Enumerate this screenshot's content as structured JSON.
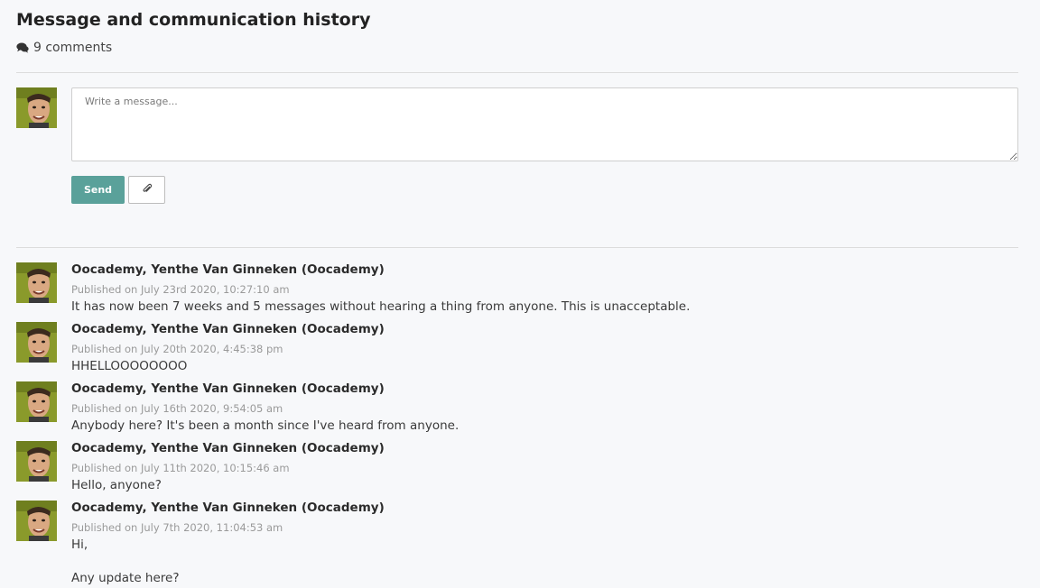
{
  "header": {
    "title": "Message and communication history",
    "comments_count": "9 comments",
    "comments_icon": "comments-icon"
  },
  "composer": {
    "placeholder": "Write a message...",
    "send_label": "Send",
    "attach_icon": "paperclip-icon"
  },
  "colors": {
    "send_button": "#5aa19a",
    "page_background": "#f7f8fa"
  },
  "messages": [
    {
      "author": "Oocademy, Yenthe Van Ginneken (Oocademy)",
      "date": "Published on July 23rd 2020, 10:27:10 am",
      "lines": [
        "It has now been 7 weeks and 5 messages without hearing a thing from anyone. This is unacceptable."
      ]
    },
    {
      "author": "Oocademy, Yenthe Van Ginneken (Oocademy)",
      "date": "Published on July 20th 2020, 4:45:38 pm",
      "lines": [
        "HHELLOOOOOOOO"
      ]
    },
    {
      "author": "Oocademy, Yenthe Van Ginneken (Oocademy)",
      "date": "Published on July 16th 2020, 9:54:05 am",
      "lines": [
        "Anybody here? It's been a month since I've heard from anyone."
      ]
    },
    {
      "author": "Oocademy, Yenthe Van Ginneken (Oocademy)",
      "date": "Published on July 11th 2020, 10:15:46 am",
      "lines": [
        "Hello, anyone?"
      ]
    },
    {
      "author": "Oocademy, Yenthe Van Ginneken (Oocademy)",
      "date": "Published on July 7th 2020, 11:04:53 am",
      "lines": [
        "Hi,",
        "Any update here?"
      ]
    }
  ]
}
